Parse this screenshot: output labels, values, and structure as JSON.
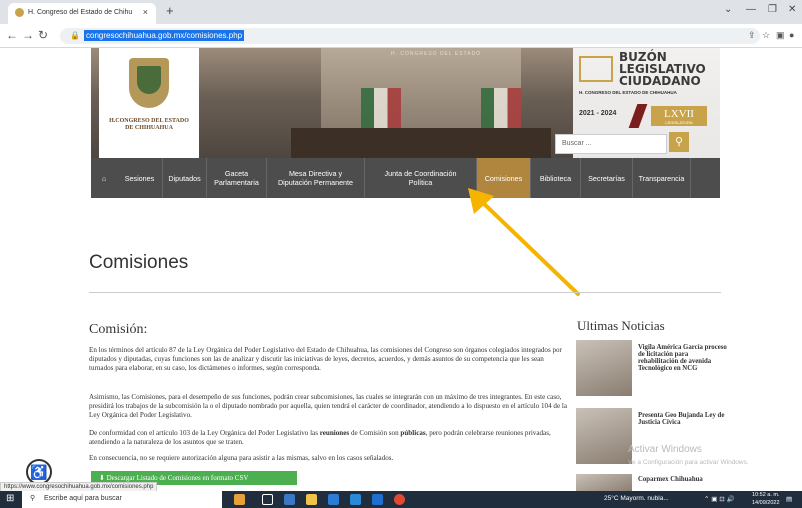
{
  "browser": {
    "tab_title": "H. Congreso del Estado de Chihu",
    "url": "congresochihuahua.gob.mx/comisiones.php",
    "new_tab": "+",
    "close_tab": "×"
  },
  "header": {
    "logo_text_line1": "H.CONGRESO DEL ESTADO",
    "logo_text_line2": "DE CHIHUAHUA",
    "frieze": "H. CONGRESO DEL ESTADO",
    "buzon_title_1": "BUZÓN",
    "buzon_title_2": "LEGISLATIVO",
    "buzon_title_3": "CIUDADANO",
    "buzon_sub": "H. CONGRESO DEL ESTADO DE CHIHUAHUA",
    "years": "2021 - 2024",
    "legislatura": "LXVII",
    "legislatura_sub": "LEGISLATURA",
    "search_placeholder": "Buscar ..."
  },
  "menu": {
    "items": [
      {
        "label": "Sesiones"
      },
      {
        "label": "Diputados"
      },
      {
        "label": "Gaceta Parlamentaria"
      },
      {
        "label": "Mesa Directiva y Diputación Permanente"
      },
      {
        "label": "Junta de Coordinación Política"
      },
      {
        "label": "Comisiones"
      },
      {
        "label": "Biblioteca"
      },
      {
        "label": "Secretarías"
      },
      {
        "label": "Transparencia"
      }
    ]
  },
  "main": {
    "title": "Comisiones",
    "subtitle": "Comisión:",
    "p1": "En los términos del artículo 87 de la Ley Orgánica del Poder Legislativo del Estado de Chihuahua, las comisiones del Congreso son órganos colegiados integrados por diputados y diputadas, cuyas funciones son las de analizar y discutir las iniciativas de leyes, decretos, acuerdos, y demás asuntos de su competencia que les sean turnados para elaborar, en su caso, los dictámenes o informes, según corresponda.",
    "p2": "Asimismo, las Comisiones, para el desempeño de sus funciones, podrán crear subcomisiones, las cuales se integrarán con un máximo de tres integrantes. En este caso, presidirá los trabajos de la subcomisión la o el diputado nombrado por aquella, quien tendrá el carácter de coordinador, atendiendo a lo dispuesto en el artículo 104 de la Ley Orgánica del Poder Legislativo.",
    "p3_a": "De conformidad con el artículo 103 de la Ley Orgánica del Poder Legislativo las ",
    "p3_b1": "reuniones",
    "p3_c": " de Comisión son ",
    "p3_b2": "públicas",
    "p3_d": ", pero podrán celebrarse reuniones privadas, atendiendo a la naturaleza de los asuntos que se traten.",
    "p4": "En consecuencia, no se requiere autorización alguna para asistir a las mismas, salvo en los casos señalados.",
    "csv_button": "Descargar Listado de Comisiones en formato CSV"
  },
  "news": {
    "title": "Ultimas Noticias",
    "items": [
      {
        "headline": "Vigila América García proceso de licitación para rehabilitación de avenida Tecnológico en NCG"
      },
      {
        "headline": "Presenta Geo Bujanda Ley de Justicia Cívica"
      },
      {
        "headline": "Coparmex Chihuahua"
      }
    ]
  },
  "overlay": {
    "activate_title": "Activar Windows",
    "activate_sub": "Ve a Configuración para activar Windows.",
    "status_url": "https://www.congresochihuahua.gob.mx/comisiones.php"
  },
  "taskbar": {
    "search_placeholder": "Escribe aquí para buscar",
    "weather": "25°C  Mayorm. nubla...",
    "time": "10:52 a. m.",
    "date": "14/09/2022"
  },
  "colors": {
    "menu_bg": "#4d4d4d",
    "menu_active": "#b0853d",
    "accent_gold": "#c8a34a",
    "csv_green": "#4caf50",
    "arrow": "#f5b400"
  }
}
